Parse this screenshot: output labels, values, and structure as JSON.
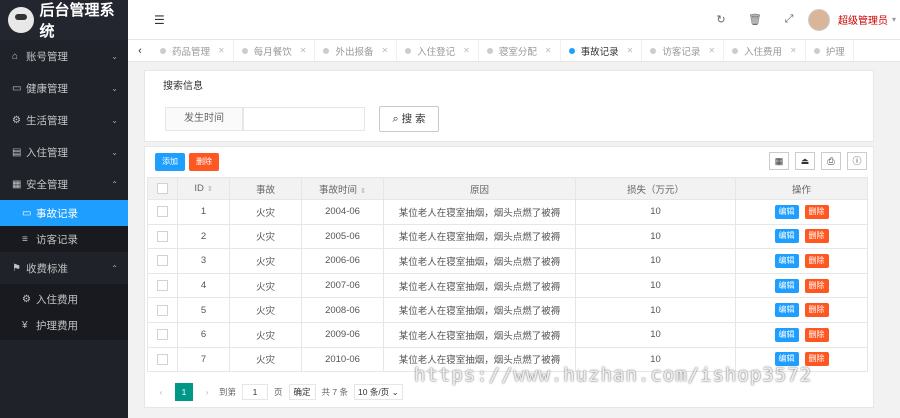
{
  "app": {
    "title": "后台管理系统"
  },
  "sidebar": {
    "items": [
      {
        "label": "账号管理",
        "icon": "home-icon",
        "glyph": "⌂"
      },
      {
        "label": "健康管理",
        "icon": "card-icon",
        "glyph": "▭"
      },
      {
        "label": "生活管理",
        "icon": "settings-icon",
        "glyph": "⚙"
      },
      {
        "label": "入住管理",
        "icon": "document-icon",
        "glyph": "▤"
      },
      {
        "label": "安全管理",
        "icon": "calendar-icon",
        "glyph": "▦"
      },
      {
        "label": "收费标准",
        "icon": "flag-icon",
        "glyph": "⚑"
      }
    ],
    "safety_sub": [
      {
        "label": "事故记录",
        "icon": "card-icon",
        "glyph": "▭"
      },
      {
        "label": "访客记录",
        "icon": "list-icon",
        "glyph": "≡"
      }
    ],
    "fee_sub": [
      {
        "label": "入住费用",
        "icon": "gear-icon",
        "glyph": "⚙"
      },
      {
        "label": "护理费用",
        "icon": "yen-icon",
        "glyph": "¥"
      }
    ]
  },
  "header": {
    "user_name": "超级管理员"
  },
  "tabs": [
    {
      "label": "药品管理"
    },
    {
      "label": "每月餐饮"
    },
    {
      "label": "外出报备"
    },
    {
      "label": "入住登记"
    },
    {
      "label": "寝室分配"
    },
    {
      "label": "事故记录",
      "active": true
    },
    {
      "label": "访客记录"
    },
    {
      "label": "入住费用"
    },
    {
      "label": "护理"
    }
  ],
  "search": {
    "legend": "搜索信息",
    "field_label": "发生时间",
    "field_value": "",
    "button_label": "搜 索"
  },
  "toolbar": {
    "add_label": "添加",
    "delete_label": "删除"
  },
  "table": {
    "columns": [
      "ID",
      "事故",
      "事故时间",
      "原因",
      "损失（万元）",
      "操作"
    ],
    "edit_label": "编辑",
    "delete_label": "删除",
    "rows": [
      {
        "id": "1",
        "event": "火灾",
        "time": "2004-06",
        "reason": "某位老人在寝室抽烟，烟头点燃了被褥",
        "loss": "10"
      },
      {
        "id": "2",
        "event": "火灾",
        "time": "2005-06",
        "reason": "某位老人在寝室抽烟，烟头点燃了被褥",
        "loss": "10"
      },
      {
        "id": "3",
        "event": "火灾",
        "time": "2006-06",
        "reason": "某位老人在寝室抽烟，烟头点燃了被褥",
        "loss": "10"
      },
      {
        "id": "4",
        "event": "火灾",
        "time": "2007-06",
        "reason": "某位老人在寝室抽烟，烟头点燃了被褥",
        "loss": "10"
      },
      {
        "id": "5",
        "event": "火灾",
        "time": "2008-06",
        "reason": "某位老人在寝室抽烟，烟头点燃了被褥",
        "loss": "10"
      },
      {
        "id": "6",
        "event": "火灾",
        "time": "2009-06",
        "reason": "某位老人在寝室抽烟，烟头点燃了被褥",
        "loss": "10"
      },
      {
        "id": "7",
        "event": "火灾",
        "time": "2010-06",
        "reason": "某位老人在寝室抽烟，烟头点燃了被褥",
        "loss": "10"
      }
    ]
  },
  "pager": {
    "current": "1",
    "goto_label": "到第",
    "goto_value": "1",
    "page_unit": "页",
    "confirm_label": "确定",
    "total_label": "共 7 条",
    "per_page": "10 条/页"
  },
  "watermark": "https://www.huzhan.com/ishop3572",
  "colors": {
    "sidebar_bg": "#20222a",
    "active_blue": "#1e9fff",
    "danger": "#ff5722",
    "pager_active": "#009688",
    "user_name": "#cc0000"
  }
}
